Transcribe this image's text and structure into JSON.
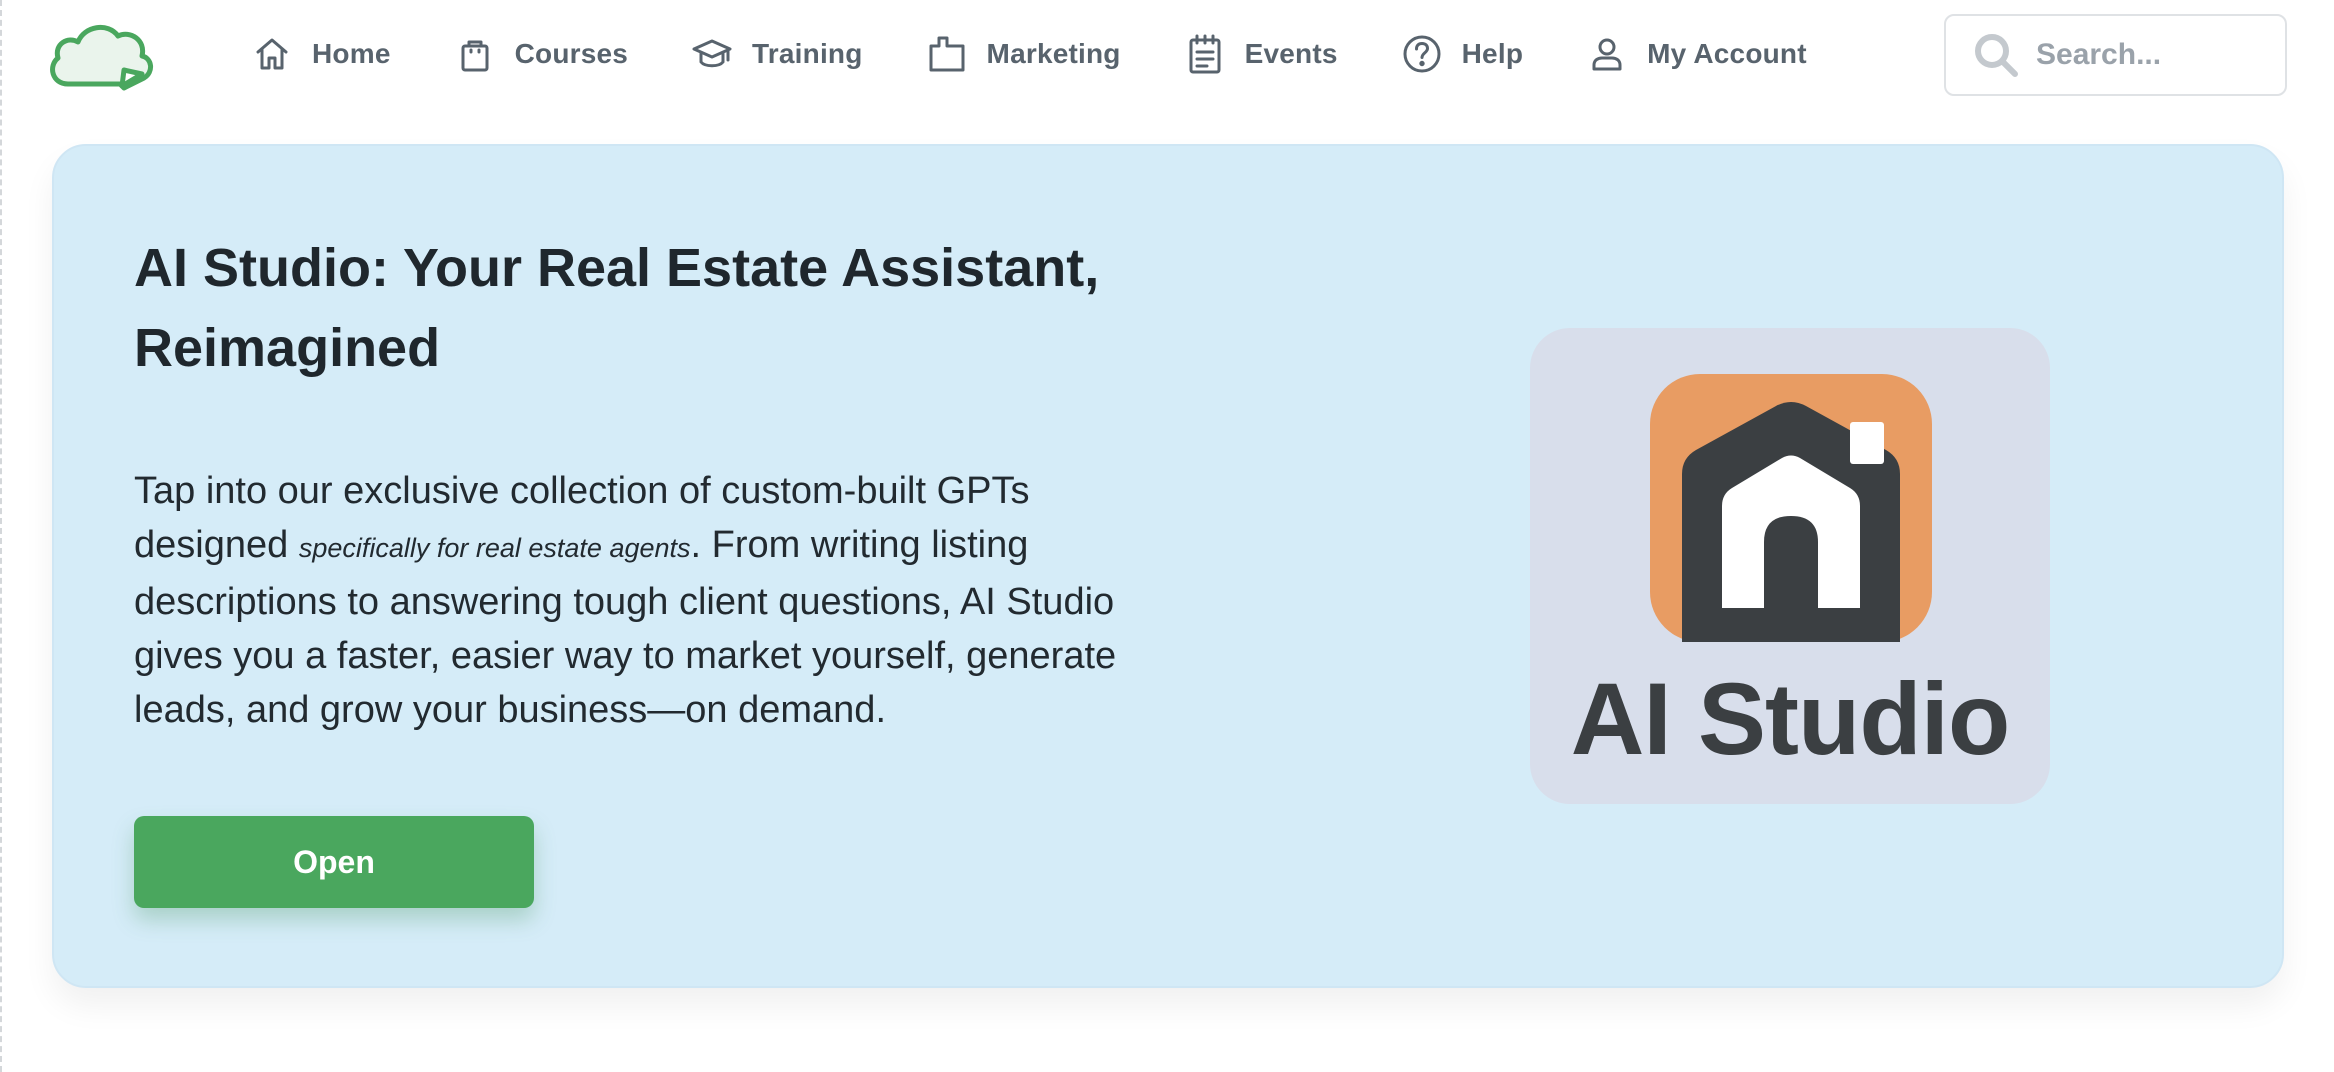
{
  "brand": {
    "logo_icon": "cloud-logo-icon",
    "accent": "#4aa75e"
  },
  "nav": {
    "items": [
      {
        "label": "Home",
        "icon": "home-icon"
      },
      {
        "label": "Courses",
        "icon": "shopping-bag-icon"
      },
      {
        "label": "Training",
        "icon": "graduation-cap-icon"
      },
      {
        "label": "Marketing",
        "icon": "folder-tab-icon"
      },
      {
        "label": "Events",
        "icon": "notepad-icon"
      },
      {
        "label": "Help",
        "icon": "question-circle-icon"
      },
      {
        "label": "My Account",
        "icon": "user-icon"
      }
    ]
  },
  "search": {
    "placeholder": "Search...",
    "value": "",
    "icon": "search-icon"
  },
  "hero": {
    "title": "AI Studio: Your Real Estate Assistant, Reimagined",
    "description": {
      "before": "Tap into our exclusive collection of custom-built GPTs designed ",
      "emphasis": "specifically for real estate agents",
      "after": ". From writing listing descriptions to answering tough client questions, AI Studio gives you a faster, easier way to market yourself, generate leads, and grow your business—on demand."
    },
    "button_label": "Open",
    "background": "#d5ecf8"
  },
  "app_tile": {
    "name": "AI Studio",
    "icon": "house-app-icon",
    "colors": {
      "tile": "#d8deeb",
      "icon_bg": "#e89c63",
      "house": "#3b3f42"
    }
  }
}
